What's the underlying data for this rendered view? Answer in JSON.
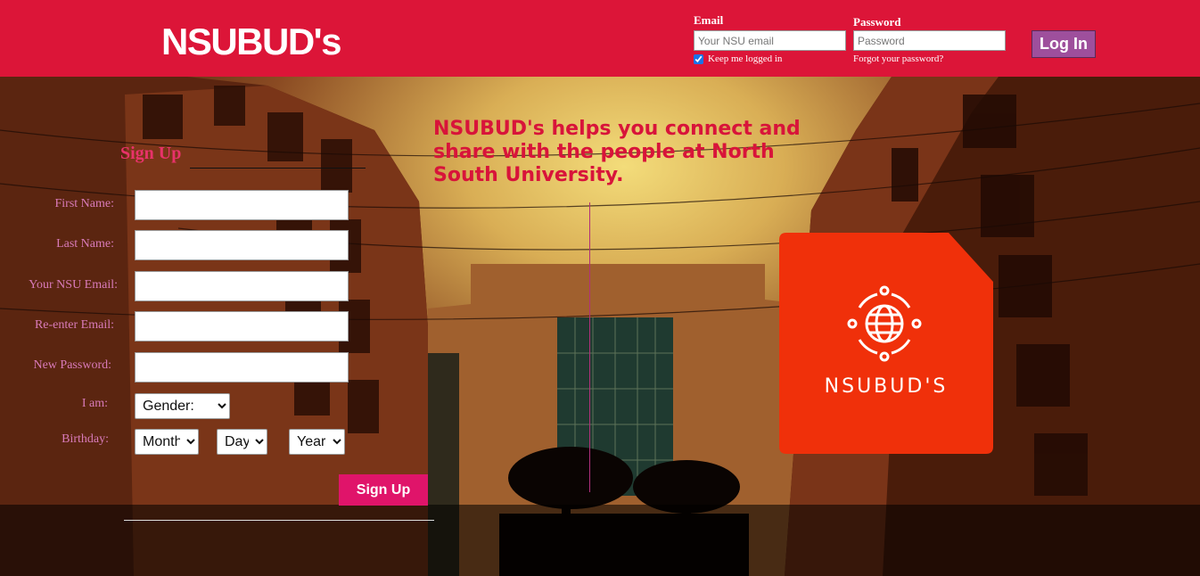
{
  "header": {
    "brand": "NSUBUD's",
    "email_label": "Email",
    "email_placeholder": "Your NSU email",
    "password_label": "Password",
    "password_placeholder": "Password",
    "keep_logged_in": "Keep me logged in",
    "forgot_password": "Forgot your password?",
    "login_button": "Log In"
  },
  "signup": {
    "title": "Sign Up",
    "fields": {
      "first_name": "First Name:",
      "last_name": "Last Name:",
      "nsu_email": "Your NSU Email:",
      "reenter_email": "Re-enter Email:",
      "new_password": "New Password:"
    },
    "gender_label": "I am:",
    "gender_selected": "Gender:",
    "birthday_label": "Birthday:",
    "month_selected": "Month",
    "day_selected": "Day",
    "year_selected": "Year",
    "submit": "Sign Up"
  },
  "tagline": "NSUBUD's helps you connect and share with the people at North South University.",
  "logo_tile": {
    "text": "NSUBUD'S",
    "color": "#f0300a"
  },
  "colors": {
    "header_bg": "#dc1538",
    "signup_title": "#e8326a",
    "label": "#d87ab8",
    "login_button": "#9e4f9c",
    "signup_button": "#e0146a",
    "tagline": "#d8143a"
  }
}
